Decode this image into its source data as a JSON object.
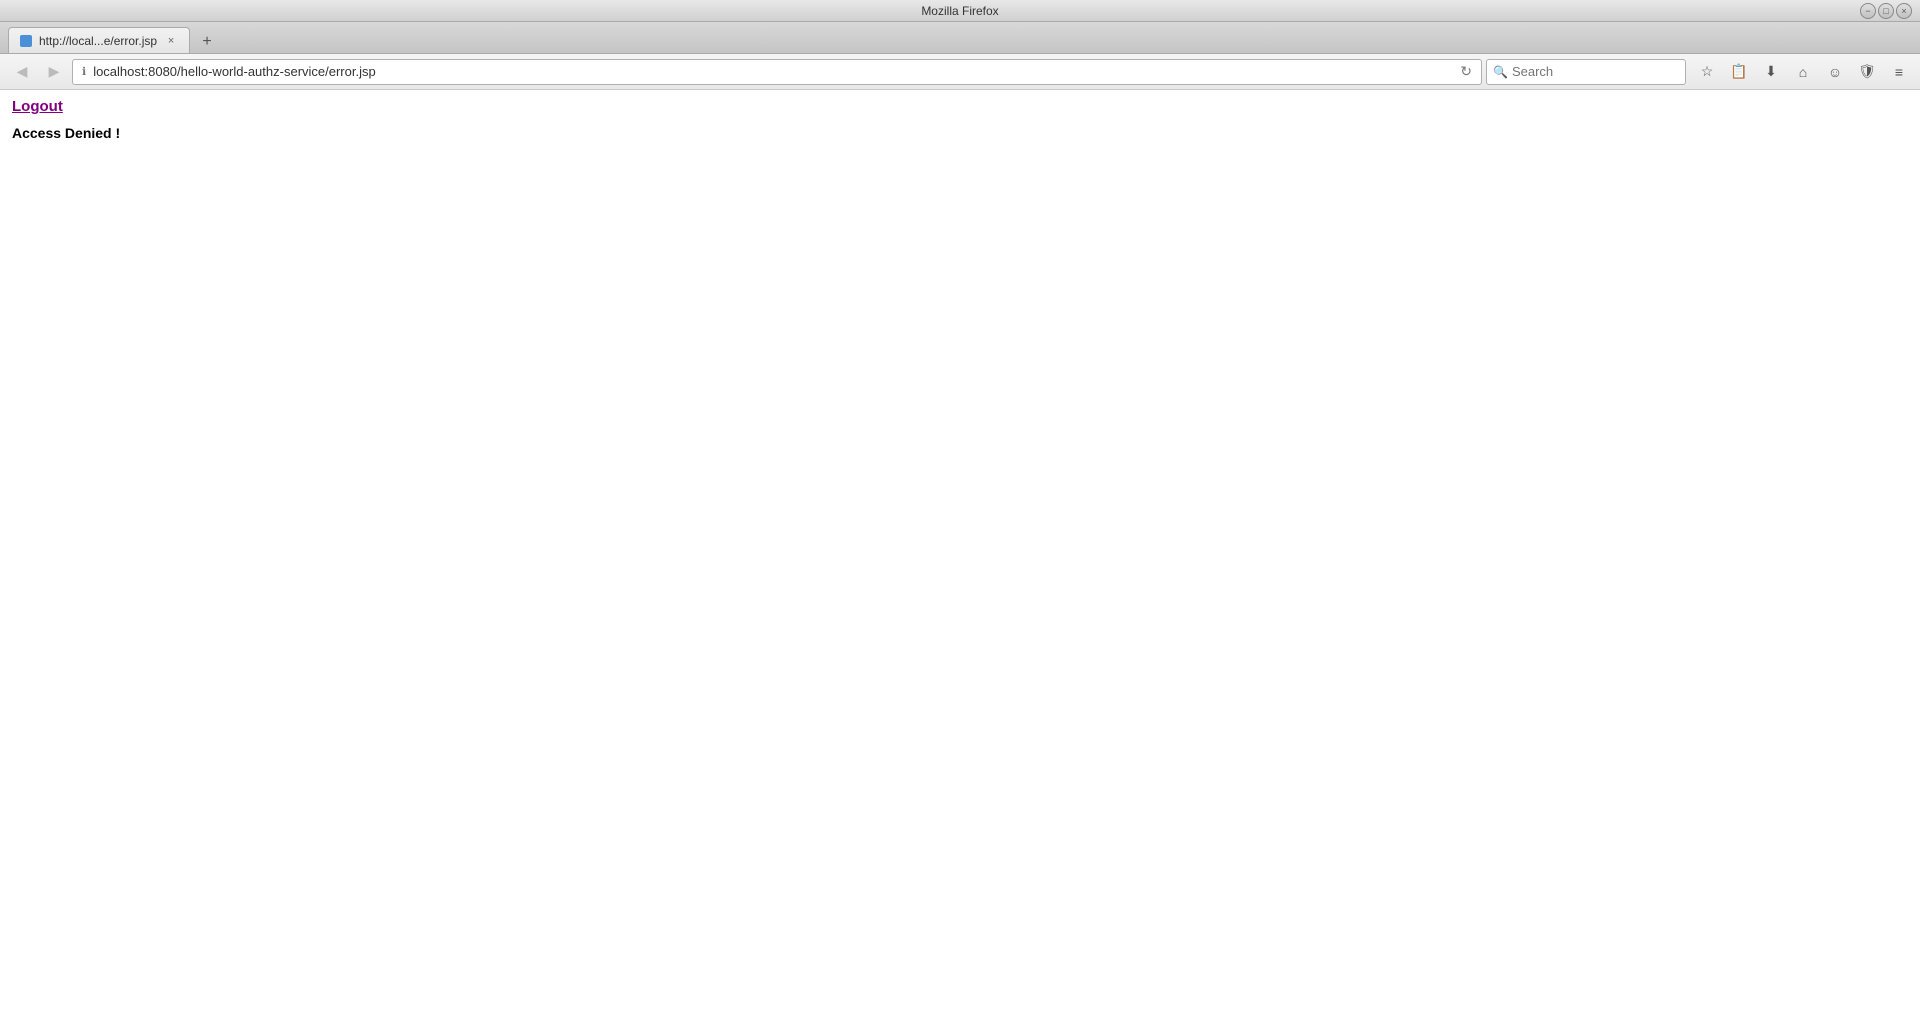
{
  "window": {
    "title": "Mozilla Firefox",
    "controls": {
      "minimize": "−",
      "maximize": "□",
      "close": "×"
    }
  },
  "tab": {
    "favicon_alt": "page icon",
    "title": "http://local...e/error.jsp",
    "close_label": "×"
  },
  "new_tab_button_label": "+",
  "navbar": {
    "back_button_label": "◀",
    "forward_button_label": "▶",
    "secure_icon_label": "ℹ",
    "address": "localhost:8080/hello-world-authz-service/error.jsp",
    "refresh_label": "↻",
    "search_placeholder": "Search",
    "toolbar": {
      "star_label": "☆",
      "bookmark_label": "📋",
      "download_label": "⬇",
      "home_label": "⌂",
      "smiley_label": "☺",
      "shield_label": "🛡",
      "menu_label": "≡"
    }
  },
  "page": {
    "logout_link_text": "Logout",
    "access_denied_text": "Access Denied !"
  }
}
